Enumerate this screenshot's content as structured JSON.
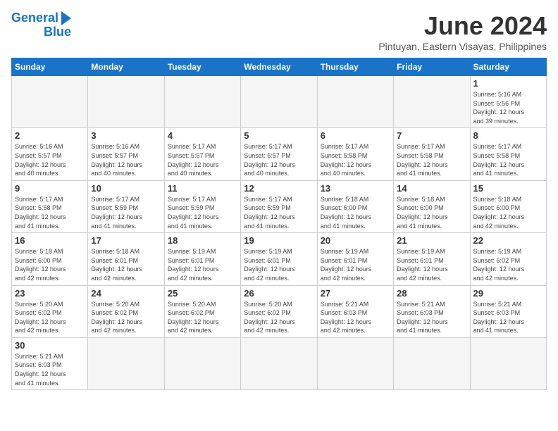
{
  "logo": {
    "line1": "General",
    "line2": "Blue"
  },
  "title": "June 2024",
  "subtitle": "Pintuyan, Eastern Visayas, Philippines",
  "weekdays": [
    "Sunday",
    "Monday",
    "Tuesday",
    "Wednesday",
    "Thursday",
    "Friday",
    "Saturday"
  ],
  "days": [
    {
      "day": "",
      "info": ""
    },
    {
      "day": "",
      "info": ""
    },
    {
      "day": "",
      "info": ""
    },
    {
      "day": "",
      "info": ""
    },
    {
      "day": "",
      "info": ""
    },
    {
      "day": "",
      "info": ""
    },
    {
      "day": "1",
      "info": "Sunrise: 5:16 AM\nSunset: 5:56 PM\nDaylight: 12 hours\nand 39 minutes."
    },
    {
      "day": "2",
      "info": "Sunrise: 5:16 AM\nSunset: 5:57 PM\nDaylight: 12 hours\nand 40 minutes."
    },
    {
      "day": "3",
      "info": "Sunrise: 5:16 AM\nSunset: 5:57 PM\nDaylight: 12 hours\nand 40 minutes."
    },
    {
      "day": "4",
      "info": "Sunrise: 5:17 AM\nSunset: 5:57 PM\nDaylight: 12 hours\nand 40 minutes."
    },
    {
      "day": "5",
      "info": "Sunrise: 5:17 AM\nSunset: 5:57 PM\nDaylight: 12 hours\nand 40 minutes."
    },
    {
      "day": "6",
      "info": "Sunrise: 5:17 AM\nSunset: 5:58 PM\nDaylight: 12 hours\nand 40 minutes."
    },
    {
      "day": "7",
      "info": "Sunrise: 5:17 AM\nSunset: 5:58 PM\nDaylight: 12 hours\nand 41 minutes."
    },
    {
      "day": "8",
      "info": "Sunrise: 5:17 AM\nSunset: 5:58 PM\nDaylight: 12 hours\nand 41 minutes."
    },
    {
      "day": "9",
      "info": "Sunrise: 5:17 AM\nSunset: 5:58 PM\nDaylight: 12 hours\nand 41 minutes."
    },
    {
      "day": "10",
      "info": "Sunrise: 5:17 AM\nSunset: 5:59 PM\nDaylight: 12 hours\nand 41 minutes."
    },
    {
      "day": "11",
      "info": "Sunrise: 5:17 AM\nSunset: 5:59 PM\nDaylight: 12 hours\nand 41 minutes."
    },
    {
      "day": "12",
      "info": "Sunrise: 5:17 AM\nSunset: 5:59 PM\nDaylight: 12 hours\nand 41 minutes."
    },
    {
      "day": "13",
      "info": "Sunrise: 5:18 AM\nSunset: 6:00 PM\nDaylight: 12 hours\nand 41 minutes."
    },
    {
      "day": "14",
      "info": "Sunrise: 5:18 AM\nSunset: 6:00 PM\nDaylight: 12 hours\nand 41 minutes."
    },
    {
      "day": "15",
      "info": "Sunrise: 5:18 AM\nSunset: 6:00 PM\nDaylight: 12 hours\nand 42 minutes."
    },
    {
      "day": "16",
      "info": "Sunrise: 5:18 AM\nSunset: 6:00 PM\nDaylight: 12 hours\nand 42 minutes."
    },
    {
      "day": "17",
      "info": "Sunrise: 5:18 AM\nSunset: 6:01 PM\nDaylight: 12 hours\nand 42 minutes."
    },
    {
      "day": "18",
      "info": "Sunrise: 5:19 AM\nSunset: 6:01 PM\nDaylight: 12 hours\nand 42 minutes."
    },
    {
      "day": "19",
      "info": "Sunrise: 5:19 AM\nSunset: 6:01 PM\nDaylight: 12 hours\nand 42 minutes."
    },
    {
      "day": "20",
      "info": "Sunrise: 5:19 AM\nSunset: 6:01 PM\nDaylight: 12 hours\nand 42 minutes."
    },
    {
      "day": "21",
      "info": "Sunrise: 5:19 AM\nSunset: 6:01 PM\nDaylight: 12 hours\nand 42 minutes."
    },
    {
      "day": "22",
      "info": "Sunrise: 5:19 AM\nSunset: 6:02 PM\nDaylight: 12 hours\nand 42 minutes."
    },
    {
      "day": "23",
      "info": "Sunrise: 5:20 AM\nSunset: 6:02 PM\nDaylight: 12 hours\nand 42 minutes."
    },
    {
      "day": "24",
      "info": "Sunrise: 5:20 AM\nSunset: 6:02 PM\nDaylight: 12 hours\nand 42 minutes."
    },
    {
      "day": "25",
      "info": "Sunrise: 5:20 AM\nSunset: 6:02 PM\nDaylight: 12 hours\nand 42 minutes."
    },
    {
      "day": "26",
      "info": "Sunrise: 5:20 AM\nSunset: 6:02 PM\nDaylight: 12 hours\nand 42 minutes."
    },
    {
      "day": "27",
      "info": "Sunrise: 5:21 AM\nSunset: 6:03 PM\nDaylight: 12 hours\nand 42 minutes."
    },
    {
      "day": "28",
      "info": "Sunrise: 5:21 AM\nSunset: 6:03 PM\nDaylight: 12 hours\nand 41 minutes."
    },
    {
      "day": "29",
      "info": "Sunrise: 5:21 AM\nSunset: 6:03 PM\nDaylight: 12 hours\nand 41 minutes."
    },
    {
      "day": "30",
      "info": "Sunrise: 5:21 AM\nSunset: 6:03 PM\nDaylight: 12 hours\nand 41 minutes."
    },
    {
      "day": "",
      "info": ""
    },
    {
      "day": "",
      "info": ""
    },
    {
      "day": "",
      "info": ""
    },
    {
      "day": "",
      "info": ""
    },
    {
      "day": "",
      "info": ""
    },
    {
      "day": "",
      "info": ""
    }
  ]
}
